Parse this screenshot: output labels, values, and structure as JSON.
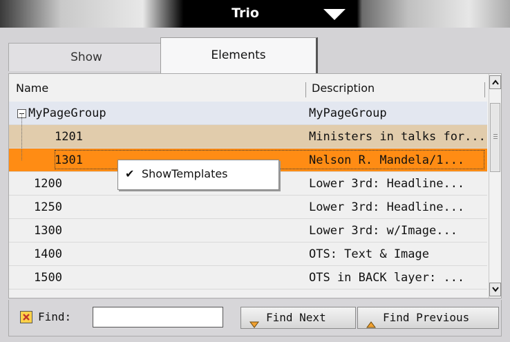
{
  "window": {
    "title": "Trio"
  },
  "tabs": [
    {
      "label": "Show"
    },
    {
      "label": "Elements"
    }
  ],
  "table": {
    "columns": {
      "name": "Name",
      "description": "Description"
    },
    "rows": [
      {
        "name": "MyPageGroup",
        "description": "MyPageGroup",
        "kind": "group"
      },
      {
        "name": "1201",
        "description": "Ministers in talks for...",
        "kind": "child"
      },
      {
        "name": "1301",
        "description": "Nelson R. Mandela/1...",
        "kind": "child-selected"
      },
      {
        "name": "1200",
        "description": "Lower 3rd: Headline...",
        "kind": "item"
      },
      {
        "name": "1250",
        "description": "Lower 3rd: Headline...",
        "kind": "item"
      },
      {
        "name": "1300",
        "description": "Lower 3rd: w/Image...",
        "kind": "item"
      },
      {
        "name": "1400",
        "description": "OTS: Text & Image",
        "kind": "item"
      },
      {
        "name": "1500",
        "description": "OTS in BACK layer: ...",
        "kind": "item"
      }
    ]
  },
  "context_menu": {
    "items": [
      {
        "label": "ShowTemplates",
        "checked": true
      }
    ]
  },
  "find_bar": {
    "label": "Find:",
    "value": "",
    "find_next_label": "Find Next",
    "find_previous_label": "Find Previous"
  },
  "colors": {
    "selected_row": "#ff8c14",
    "highlight_row": "#e1ccac",
    "group_row": "#e3e7f0"
  }
}
